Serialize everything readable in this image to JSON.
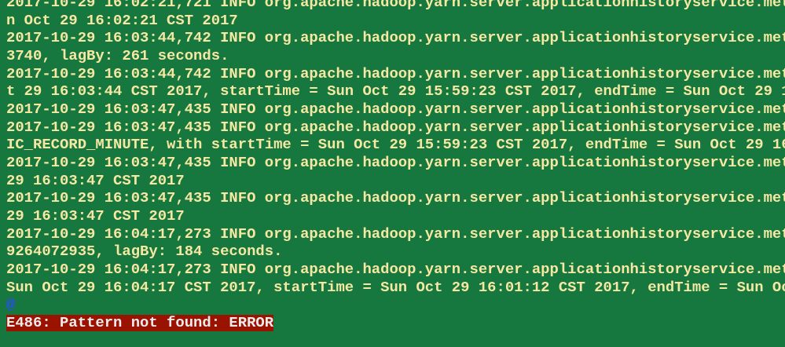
{
  "terminal": {
    "lines": [
      "2017-10-29 16:02:21,721 INFO org.apache.hadoop.yarn.server.applicationhistoryservice.met",
      "n Oct 29 16:02:21 CST 2017",
      "2017-10-29 16:03:44,742 INFO org.apache.hadoop.yarn.server.applicationhistoryservice.met",
      "3740, lagBy: 261 seconds.",
      "2017-10-29 16:03:44,742 INFO org.apache.hadoop.yarn.server.applicationhistoryservice.met",
      "t 29 16:03:44 CST 2017, startTime = Sun Oct 29 15:59:23 CST 2017, endTime = Sun Oct 29 1",
      "2017-10-29 16:03:47,435 INFO org.apache.hadoop.yarn.server.applicationhistoryservice.met",
      "2017-10-29 16:03:47,435 INFO org.apache.hadoop.yarn.server.applicationhistoryservice.met",
      "IC_RECORD_MINUTE, with startTime = Sun Oct 29 15:59:23 CST 2017, endTime = Sun Oct 29 16",
      "2017-10-29 16:03:47,435 INFO org.apache.hadoop.yarn.server.applicationhistoryservice.met",
      "29 16:03:47 CST 2017",
      "2017-10-29 16:03:47,435 INFO org.apache.hadoop.yarn.server.applicationhistoryservice.met",
      "29 16:03:47 CST 2017",
      "2017-10-29 16:04:17,273 INFO org.apache.hadoop.yarn.server.applicationhistoryservice.met",
      "9264072935, lagBy: 184 seconds.",
      "2017-10-29 16:04:17,273 INFO org.apache.hadoop.yarn.server.applicationhistoryservice.met",
      "Sun Oct 29 16:04:17 CST 2017, startTime = Sun Oct 29 16:01:12 CST 2017, endTime = Sun Oc"
    ],
    "continuation_marker": "@",
    "error_message": "E486: Pattern not found: ERROR"
  },
  "colors": {
    "background": "#16773f",
    "text": "#f6e8a2",
    "error_bg": "#9a1200",
    "marker": "#2a4bff"
  }
}
